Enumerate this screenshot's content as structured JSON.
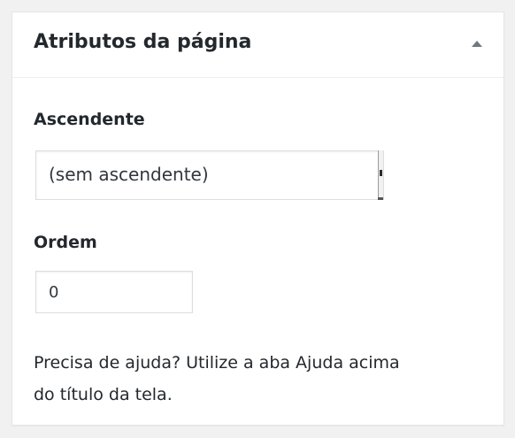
{
  "panel": {
    "title": "Atributos da página",
    "toggle_icon": "arrow-up-icon"
  },
  "parent": {
    "label": "Ascendente",
    "selected": "(sem ascendente)"
  },
  "order": {
    "label": "Ordem",
    "value": "0"
  },
  "help": {
    "line1": "Precisa de ajuda? Utilize a aba Ajuda acima",
    "line2": "do título da tela."
  }
}
